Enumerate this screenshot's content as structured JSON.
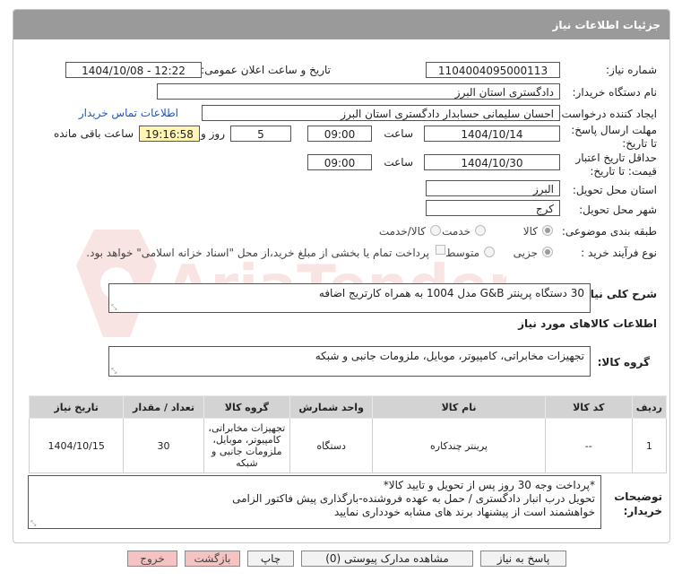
{
  "header": {
    "title": "جزئیات اطلاعات نیاز"
  },
  "fields": {
    "need_number_label": "شماره نیاز:",
    "need_number": "1104004095000113",
    "announce_label": "تاریخ و ساعت اعلان عمومی:",
    "announce_value": "1404/10/08 - 12:22",
    "buyer_org_label": "نام دستگاه خریدار:",
    "buyer_org": "دادگستری استان البرز",
    "requester_label": "ایجاد کننده درخواست:",
    "requester": "احسان سلیمانی حسابدار دادگستری استان البرز",
    "contact_link": "اطلاعات تماس خریدار",
    "deadline_label": "مهلت ارسال پاسخ: تا تاریخ:",
    "deadline_date": "1404/10/14",
    "time_label": "ساعت",
    "deadline_time": "09:00",
    "days_value": "5",
    "days_label": "روز و",
    "remaining_time": "19:16:58",
    "remaining_label": "ساعت باقی مانده",
    "validity_label": "حداقل تاریخ اعتبار قیمت: تا تاریخ:",
    "validity_date": "1404/10/30",
    "validity_time_label": "ساعت",
    "validity_time": "09:00",
    "province_label": "استان محل تحویل:",
    "province": "البرز",
    "city_label": "شهر محل تحویل:",
    "city": "کرج",
    "category_label": "طبقه بندی موضوعی:",
    "category_options": [
      "کالا",
      "خدمت",
      "کالا/خدمت"
    ],
    "process_label": "نوع فرآیند خرید :",
    "process_options": [
      "جزیی",
      "متوسط"
    ],
    "payment_note": "پرداخت تمام یا بخشی از مبلغ خرید،از محل \"اسناد خزانه اسلامی\" خواهد بود."
  },
  "description": {
    "label": "شرح کلی نیاز:",
    "text": "30 دستگاه پرینتر G&B مدل 1004 به همراه کارتریج اضافه"
  },
  "goods_info": {
    "title": "اطلاعات کالاهای مورد نیاز",
    "group_label": "گروه کالا:",
    "group_value": "تجهیزات مخابراتی، کامپیوتر، موبایل، ملزومات جانبی و شبکه"
  },
  "table": {
    "headers": [
      "ردیف",
      "کد کالا",
      "نام کالا",
      "واحد شمارش",
      "گروه کالا",
      "تعداد / مقدار",
      "تاریخ نیاز"
    ],
    "rows": [
      {
        "row": "1",
        "code": "--",
        "name": "پرینتر چندکاره",
        "unit": "دستگاه",
        "group": "تجهیزات مخابراتی، کامپیوتر، موبایل، ملزومات جانبی و شبکه",
        "qty": "30",
        "date": "1404/10/15"
      }
    ]
  },
  "buyer_notes": {
    "label": "توضیحات خریدار:",
    "lines": [
      "*پرداخت وجه 30 روز پس از تحویل  و تایید کالا*",
      "تحویل درب انبار دادگستری / حمل به عهده فروشنده-بارگذاری پیش فاکتور الزامی",
      "خواهشمند است از پیشنهاد برند های مشابه خودداری نمایید"
    ]
  },
  "buttons": {
    "reply": "پاسخ به نیاز",
    "docs": "مشاهده مدارک پیوستی (0)",
    "print": "چاپ",
    "back": "بازگشت",
    "exit": "خروج"
  },
  "watermark": {
    "text": "AriaTender.net"
  },
  "colors": {
    "header_bg": "#9a9a9a",
    "link": "#1a56c6",
    "highlight": "#fff5b5",
    "pink_button": "#f6c3c3"
  }
}
